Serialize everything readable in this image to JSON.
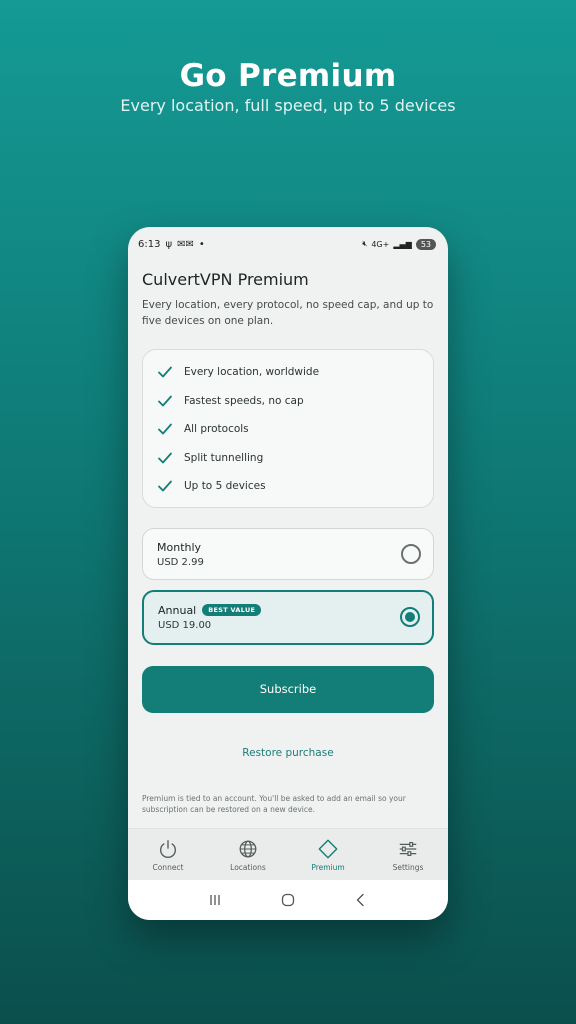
{
  "hero": {
    "title": "Go Premium",
    "subtitle": "Every location, full speed, up to 5 devices"
  },
  "status_bar": {
    "time": "6:13",
    "network": "4G+",
    "battery": "53"
  },
  "page": {
    "title": "CulvertVPN Premium",
    "description": "Every location, every protocol, no speed cap, and up to five devices on one plan."
  },
  "features": [
    "Every location, worldwide",
    "Fastest speeds, no cap",
    "All protocols",
    "Split tunnelling",
    "Up to 5 devices"
  ],
  "plans": [
    {
      "name": "Monthly",
      "price": "USD 2.99",
      "selected": false,
      "badge": ""
    },
    {
      "name": "Annual",
      "price": "USD 19.00",
      "selected": true,
      "badge": "BEST VALUE"
    }
  ],
  "actions": {
    "subscribe_label": "Subscribe",
    "restore_label": "Restore purchase"
  },
  "footnote": "Premium is tied to an account. You'll be asked to add an email so your subscription can be restored on a new device.",
  "bottom_nav": [
    {
      "label": "Connect",
      "icon": "power-icon",
      "active": false
    },
    {
      "label": "Locations",
      "icon": "globe-icon",
      "active": false
    },
    {
      "label": "Premium",
      "icon": "diamond-icon",
      "active": true
    },
    {
      "label": "Settings",
      "icon": "sliders-icon",
      "active": false
    }
  ],
  "colors": {
    "accent": "#137d77",
    "background_top": "#159a95",
    "background_bottom": "#0b4f4c"
  }
}
